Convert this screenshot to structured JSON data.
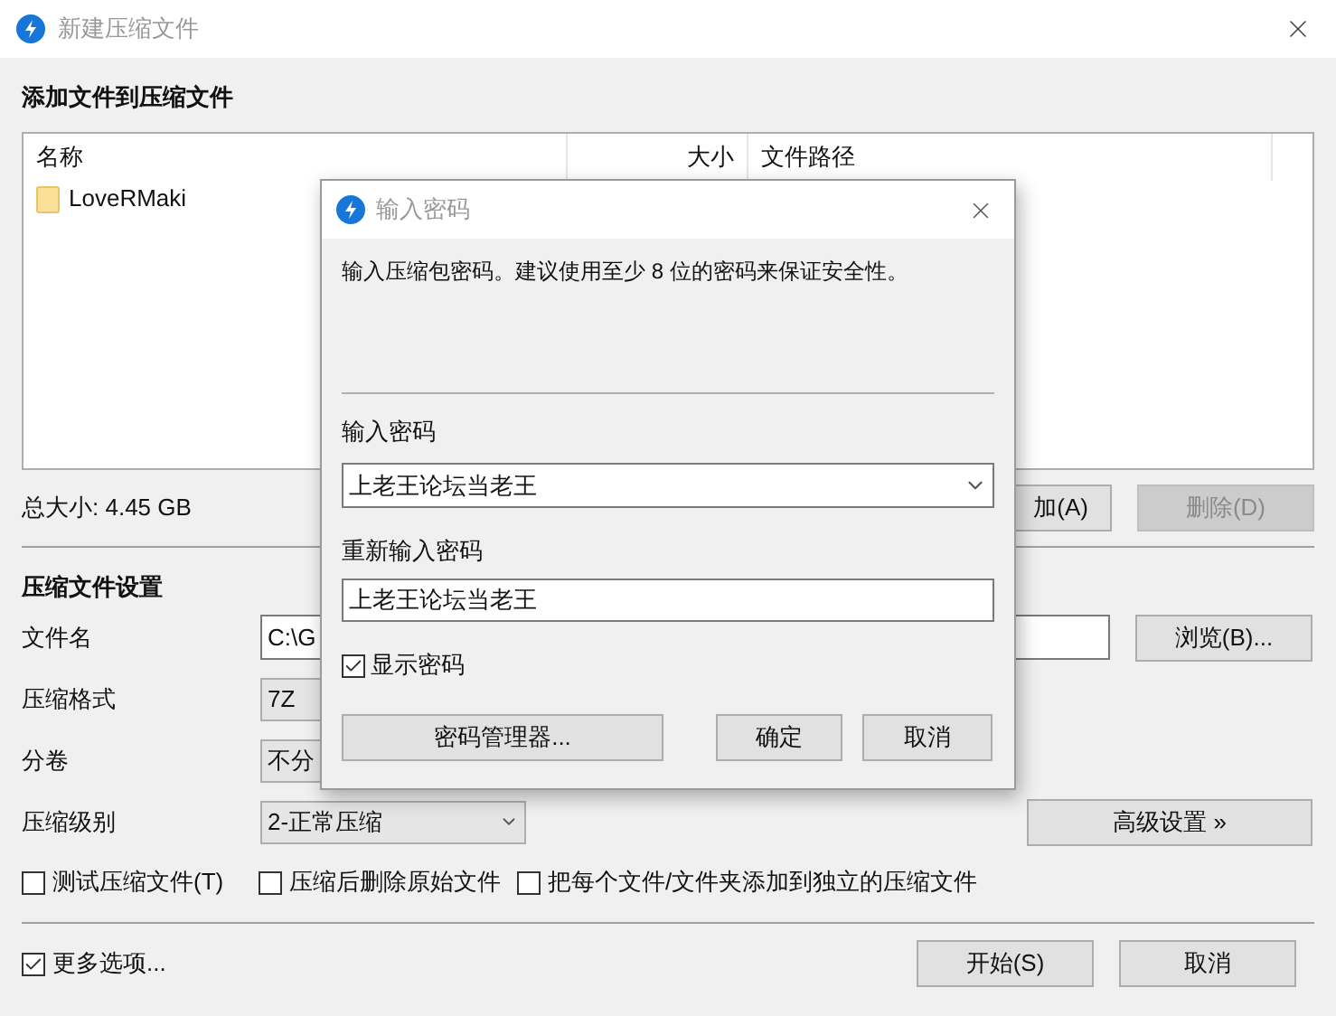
{
  "window": {
    "title": "新建压缩文件"
  },
  "add_section": {
    "heading": "添加文件到压缩文件",
    "columns": [
      "名称",
      "大小",
      "文件路径"
    ],
    "rows": [
      {
        "name": "LoveRMaki"
      }
    ],
    "total_size": "总大小: 4.45 GB",
    "buttons": [
      {
        "label": "加(A)",
        "disabled": false
      },
      {
        "label": "删除(D)",
        "disabled": true
      }
    ]
  },
  "settings": {
    "heading": "压缩文件设置",
    "fields": [
      {
        "label": "文件名",
        "kind": "text",
        "value": "C:\\G"
      },
      {
        "label": "压缩格式",
        "kind": "select",
        "value": "7Z"
      },
      {
        "label": "分卷",
        "kind": "select",
        "value": "不分"
      },
      {
        "label": "压缩级别",
        "kind": "select",
        "value": "2-正常压缩"
      }
    ],
    "browse_button": "浏览(B)...",
    "advanced_button": "高级设置 »",
    "options": [
      {
        "label": "测试压缩文件(T)",
        "checked": false
      },
      {
        "label": "压缩后删除原始文件",
        "checked": false
      },
      {
        "label": "把每个文件/文件夹添加到独立的压缩文件",
        "checked": false
      }
    ]
  },
  "footer": {
    "more_options": {
      "label": "更多选项...",
      "checked": true
    },
    "buttons": [
      "开始(S)",
      "取消"
    ]
  },
  "dialog": {
    "title": "输入密码",
    "message": "输入压缩包密码。建议使用至少 8 位的密码来保证安全性。",
    "password_label": "输入密码",
    "password": "上老王论坛当老王",
    "confirm_label": "重新输入密码",
    "confirm_password": "上老王论坛当老王",
    "show_password": {
      "label": "显示密码",
      "checked": true
    },
    "buttons": [
      "密码管理器...",
      "确定",
      "取消"
    ]
  }
}
